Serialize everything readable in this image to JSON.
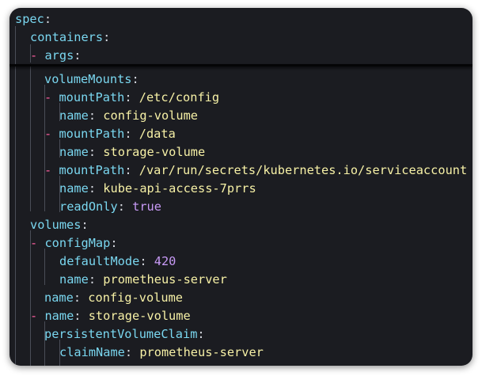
{
  "editor": {
    "sticky_lines": [
      {
        "key": "spec"
      },
      {
        "key": "containers"
      },
      {
        "dash": "-",
        "key": "args"
      }
    ],
    "lines": [
      {
        "key": "volumeMounts"
      },
      {
        "dash": "-",
        "key": "mountPath",
        "value": "/etc/config"
      },
      {
        "key": "name",
        "value": "config-volume"
      },
      {
        "dash": "-",
        "key": "mountPath",
        "value": "/data"
      },
      {
        "key": "name",
        "value": "storage-volume"
      },
      {
        "dash": "-",
        "key": "mountPath",
        "value": "/var/run/secrets/kubernetes.io/serviceaccount"
      },
      {
        "key": "name",
        "value": "kube-api-access-7prrs"
      },
      {
        "key": "readOnly",
        "value": "true"
      },
      {
        "key": "volumes"
      },
      {
        "dash": "-",
        "key": "configMap"
      },
      {
        "key": "defaultMode",
        "value": "420"
      },
      {
        "key": "name",
        "value": "prometheus-server"
      },
      {
        "key": "name",
        "value": "config-volume"
      },
      {
        "dash": "-",
        "key": "name",
        "value": "storage-volume"
      },
      {
        "key": "persistentVolumeClaim"
      },
      {
        "key": "claimName",
        "value": "prometheus-server"
      }
    ],
    "colors": {
      "background": "#1b1c21",
      "key": "#7ad7f0",
      "string_value": "#f7f1a6",
      "number_boolean": "#c89af6",
      "dash": "#ff5ea0"
    }
  }
}
